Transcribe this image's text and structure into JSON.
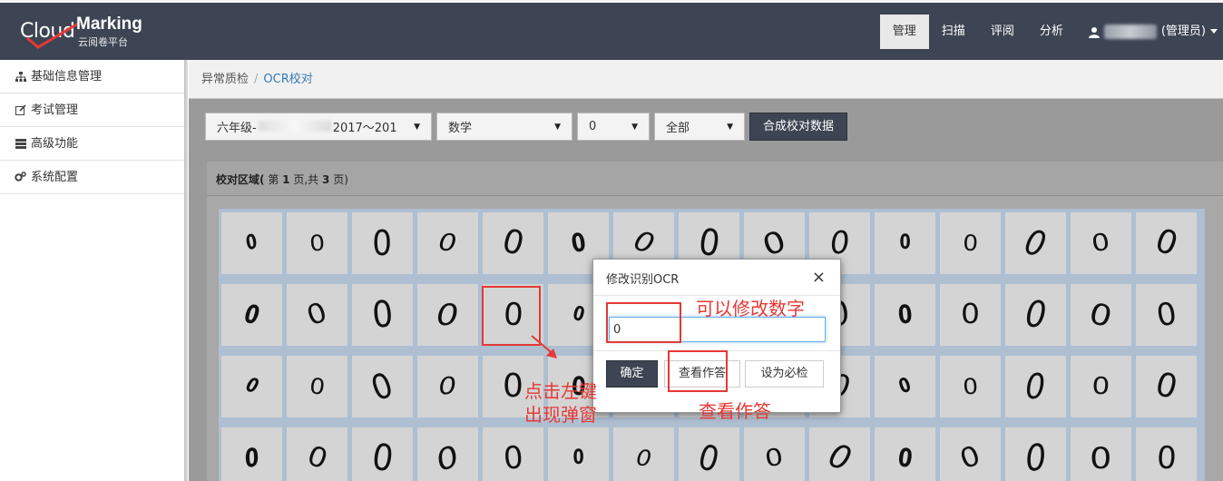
{
  "app": {
    "logo_cloud": "Cloud",
    "logo_marking": "Marking",
    "logo_sub": "云阅卷平台"
  },
  "nav": {
    "items": [
      {
        "label": "管理",
        "active": true
      },
      {
        "label": "扫描",
        "active": false
      },
      {
        "label": "评阅",
        "active": false
      },
      {
        "label": "分析",
        "active": false
      }
    ],
    "user_role": "(管理员)",
    "user_icon": "user-icon",
    "dropdown_icon": "caret-down-icon"
  },
  "sidebar": {
    "items": [
      {
        "label": "基础信息管理",
        "icon": "sitemap-icon"
      },
      {
        "label": "考试管理",
        "icon": "edit-icon"
      },
      {
        "label": "高级功能",
        "icon": "list-icon"
      },
      {
        "label": "系统配置",
        "icon": "gears-icon"
      }
    ]
  },
  "breadcrumb": {
    "parent": "异常质检",
    "separator": "/",
    "current": "OCR校对"
  },
  "filters": {
    "grade_prefix": "六年级-",
    "grade_suffix": "2017～201",
    "subject": "数学",
    "value": "0",
    "scope": "全部",
    "merge_button": "合成校对数据"
  },
  "panel": {
    "title_prefix": "校对区域(",
    "page_label": "第",
    "page_current": "1",
    "page_unit": "页,共",
    "page_total": "3",
    "page_end": "页)"
  },
  "grid": {
    "cells": [
      "0",
      "0",
      "0",
      "0",
      "0",
      "0",
      "0",
      "0",
      "0",
      "0",
      "0",
      "0",
      "0",
      "0",
      "0",
      "0",
      "0",
      "0",
      "0",
      "0",
      "0",
      "0",
      "0",
      "0",
      "0",
      "0",
      "0",
      "0",
      "0",
      "0",
      "0",
      "0",
      "0",
      "0",
      "0",
      "0",
      "0",
      "0",
      "0",
      "0",
      "0",
      "0",
      "0",
      "0",
      "0",
      "0",
      "0",
      "0",
      "0",
      "0",
      "0",
      "0",
      "0",
      "0",
      "0",
      "0",
      "0",
      "0",
      "0",
      "0"
    ]
  },
  "modal": {
    "title": "修改识别OCR",
    "close": "×",
    "input_value": "0",
    "ok_button": "确定",
    "view_answer_button": "查看作答",
    "set_required_button": "设为必检"
  },
  "annotations": {
    "edit_number": "可以修改数字",
    "click_popup_line1": "点击左键",
    "click_popup_line2": "出现弹窗",
    "view_answer": "查看作答"
  },
  "colors": {
    "topbar": "#3d4453",
    "accent_blue": "#337ab7",
    "annotation_red": "#e53935"
  }
}
